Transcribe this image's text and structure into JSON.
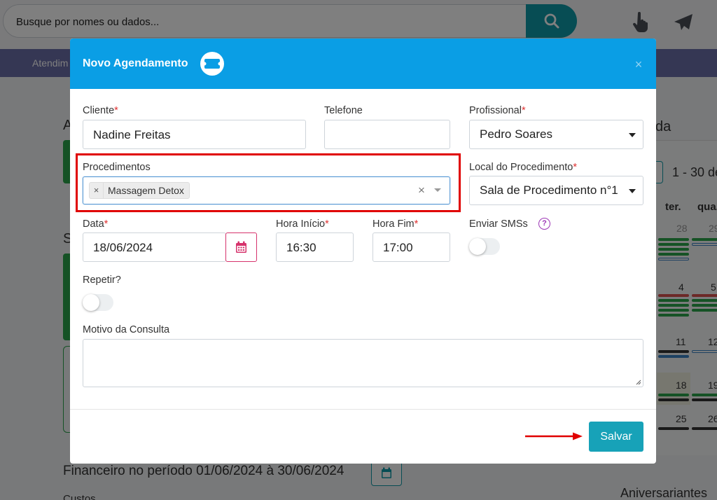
{
  "search": {
    "placeholder": "Busque por nomes ou dados..."
  },
  "nav": {
    "first_item": "Atendim"
  },
  "background": {
    "letter_a": "A",
    "letter_s": "S",
    "right_letter": "da",
    "financeiro_title": "Financeiro no período 01/06/2024 à 30/06/2024",
    "costs_label": "Custos",
    "birthdays_label": "Aniversariantes",
    "calendar": {
      "range": "1 - 30 de",
      "weekdays": [
        "ter.",
        "qua."
      ],
      "days": [
        "28",
        "29",
        "4",
        "5",
        "11",
        "12",
        "18",
        "19",
        "25",
        "26"
      ]
    }
  },
  "modal": {
    "title": "Novo Agendamento",
    "close_label": "×",
    "fields": {
      "cliente": {
        "label": "Cliente",
        "required": "*",
        "value": "Nadine Freitas"
      },
      "telefone": {
        "label": "Telefone",
        "value": ""
      },
      "profissional": {
        "label": "Profissional",
        "required": "*",
        "value": "Pedro Soares"
      },
      "procedimentos": {
        "label": "Procedimentos",
        "tags": [
          "Massagem Detox"
        ],
        "tag_remove": "×",
        "clear": "×"
      },
      "local": {
        "label": "Local do Procedimento",
        "required": "*",
        "value": "Sala de Procedimento n°1"
      },
      "data": {
        "label": "Data",
        "required": "*",
        "value": "18/06/2024"
      },
      "hora_inicio": {
        "label": "Hora Início",
        "required": "*",
        "value": "16:30"
      },
      "hora_fim": {
        "label": "Hora Fim",
        "required": "*",
        "value": "17:00"
      },
      "enviar_sms": {
        "label": "Enviar SMSs",
        "help": "?",
        "checked": false
      },
      "repetir": {
        "label": "Repetir?",
        "checked": false
      },
      "motivo": {
        "label": "Motivo da Consulta",
        "value": ""
      }
    },
    "save_label": "Salvar"
  },
  "colors": {
    "header": "#0a9ee5",
    "teal": "#17a2b8",
    "annotation_red": "#e00000",
    "required_red": "#e03131",
    "nav_bg": "#6a6fa8"
  }
}
